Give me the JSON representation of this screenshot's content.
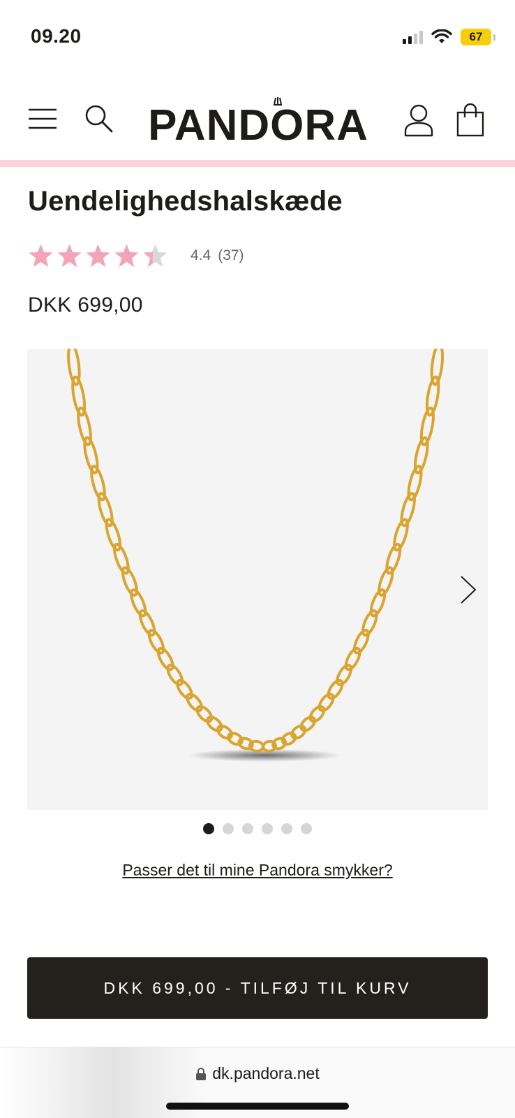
{
  "status_bar": {
    "time": "09.20",
    "battery": "67"
  },
  "header": {
    "brand": "PANDORA"
  },
  "product": {
    "title": "Uendelighedshalskæde",
    "rating_value": "4.4",
    "rating_count": "(37)",
    "rating_stars": 4.4,
    "rating_max": 5,
    "price": "DKK 699,00"
  },
  "gallery": {
    "image_count": 6,
    "active_index": 0
  },
  "links": {
    "fit_check": "Passer det til mine Pandora smykker?"
  },
  "cta": {
    "label": "DKK 699,00 - TILFØJ TIL KURV"
  },
  "browser": {
    "url": "dk.pandora.net"
  },
  "colors": {
    "star_filled": "#f3a5b8",
    "star_empty": "#d9d9d9",
    "accent_pink": "#fcd3da",
    "cta_bg": "#24211d",
    "gold": "#d9a430"
  },
  "icons": [
    "menu-icon",
    "search-icon",
    "account-icon",
    "bag-icon",
    "chevron-right-icon",
    "lock-icon"
  ]
}
